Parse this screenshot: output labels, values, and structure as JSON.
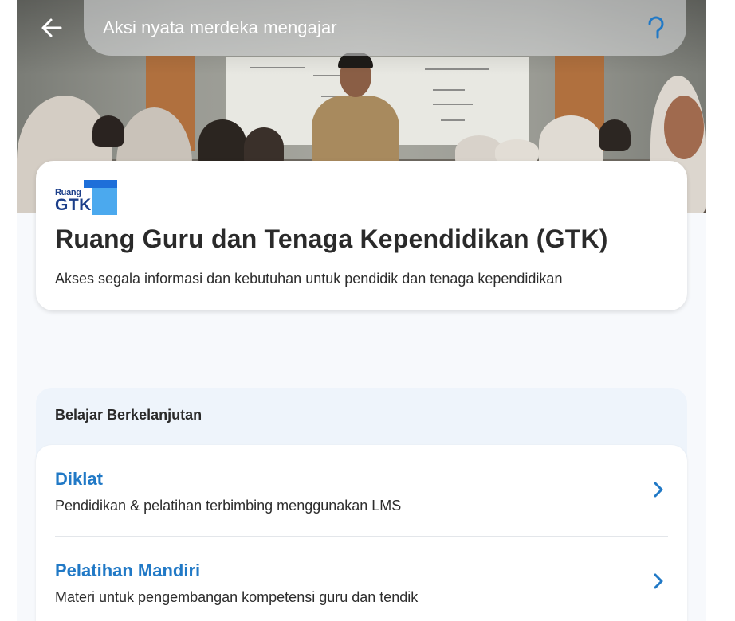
{
  "search": {
    "text": "Aksi nyata merdeka mengajar"
  },
  "card": {
    "logo_small": "Ruang",
    "logo_big": "GTK",
    "title": "Ruang Guru dan Tenaga Kependidikan (GTK)",
    "subtitle": "Akses segala informasi dan kebutuhan untuk pendidik dan tenaga kependidikan"
  },
  "section": {
    "title": "Belajar Berkelanjutan",
    "items": [
      {
        "title": "Diklat",
        "description": "Pendidikan & pelatihan terbimbing menggunakan LMS"
      },
      {
        "title": "Pelatihan Mandiri",
        "description": "Materi untuk pengembangan kompetensi guru dan tendik"
      }
    ]
  },
  "colors": {
    "accent": "#2179c6",
    "logo_dark": "#1c3f8a",
    "logo_light": "#4ba9ee"
  },
  "icons": [
    "back-arrow-icon",
    "search-icon",
    "chevron-right-icon"
  ]
}
